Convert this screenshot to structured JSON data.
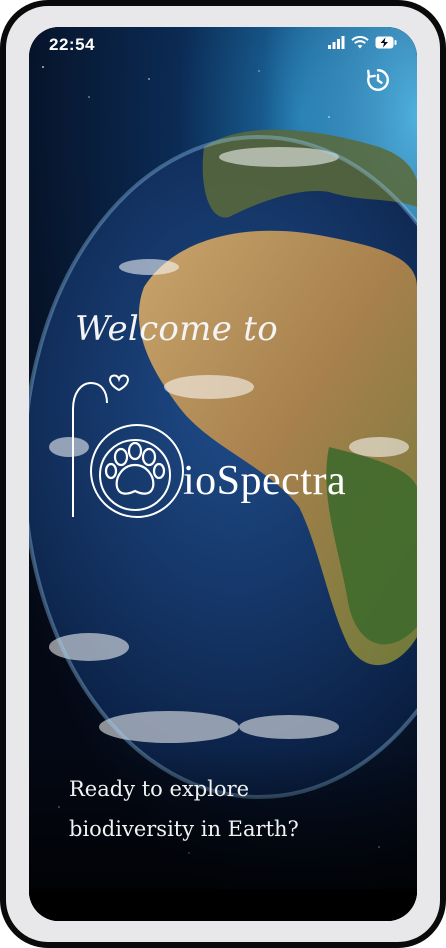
{
  "status_bar": {
    "time": "22:54",
    "icons": [
      "signal-icon",
      "wifi-icon",
      "battery-charging-icon"
    ]
  },
  "top_action": {
    "icon": "history-icon"
  },
  "hero": {
    "welcome": "Welcome to",
    "brand_text": "ioSpectra",
    "logo_icon": "paw-b-logo-icon"
  },
  "tagline": {
    "line1": "Ready to explore",
    "line2": "biodiversity in Earth?"
  },
  "colors": {
    "text": "#ffffff",
    "space": "#050a18",
    "ocean": "#163a73",
    "land": "#b89560",
    "frame": "#0a0a0a"
  }
}
